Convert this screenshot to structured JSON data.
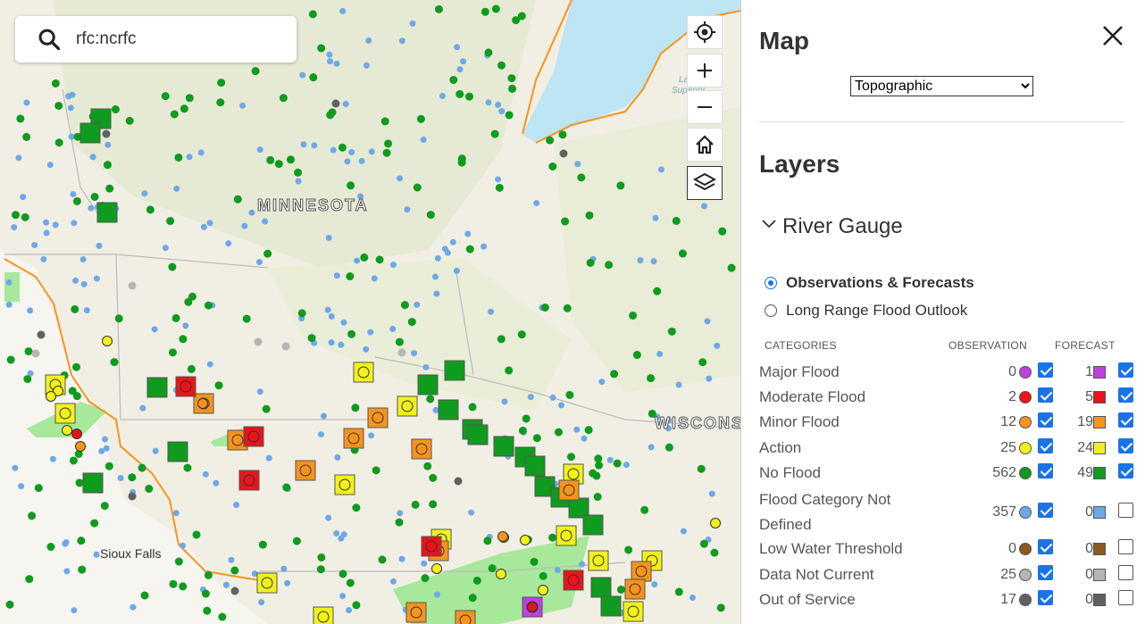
{
  "search": {
    "value": "rfc:ncrfc",
    "placeholder": ""
  },
  "map": {
    "labels": {
      "state_mn": "MINNESOTA",
      "state_wi": "WISCONSIN",
      "city_sf": "Sioux Falls",
      "lake_1": "Lake",
      "lake_2": "Superior"
    },
    "controls": [
      "locate",
      "zoom-in",
      "zoom-out",
      "home",
      "layers"
    ]
  },
  "panel": {
    "map_title": "Map",
    "basemap": {
      "selected": "Topographic",
      "options": [
        "Topographic"
      ]
    },
    "layers_title": "Layers",
    "river_gauge": {
      "label": "River Gauge",
      "expanded": true
    },
    "modes": [
      {
        "label": "Observations & Forecasts",
        "selected": true
      },
      {
        "label": "Long Range Flood Outlook",
        "selected": false
      }
    ],
    "columns": {
      "categories": "CATEGORIES",
      "observation": "OBSERVATION",
      "forecast": "FORECAST"
    },
    "categories": [
      {
        "label": "Major Flood",
        "obs": "0",
        "obs_color": "#c040e0",
        "obs_on": true,
        "fc": "1",
        "fc_color": "#c040e0",
        "fc_on": true
      },
      {
        "label": "Moderate Flood",
        "obs": "2",
        "obs_color": "#e8141b",
        "obs_on": true,
        "fc": "5",
        "fc_color": "#e8141b",
        "fc_on": true
      },
      {
        "label": "Minor Flood",
        "obs": "12",
        "obs_color": "#f7941d",
        "obs_on": true,
        "fc": "19",
        "fc_color": "#f7941d",
        "fc_on": true
      },
      {
        "label": "Action",
        "obs": "25",
        "obs_color": "#f2f21a",
        "obs_on": true,
        "fc": "24",
        "fc_color": "#f2f21a",
        "fc_on": true
      },
      {
        "label": "No Flood",
        "obs": "562",
        "obs_color": "#0f9b1e",
        "obs_on": true,
        "fc": "49",
        "fc_color": "#0f9b1e",
        "fc_on": true
      },
      {
        "label_1": "Flood Category Not",
        "label_2": "Defined",
        "obs": "357",
        "obs_color": "#6fa8e8",
        "obs_on": true,
        "fc": "0",
        "fc_color": "#6fa8e8",
        "fc_on": false
      },
      {
        "label": "Low Water Threshold",
        "obs": "0",
        "obs_color": "#8b5a1e",
        "obs_on": true,
        "fc": "0",
        "fc_color": "#8b5a1e",
        "fc_on": false
      },
      {
        "label": "Data Not Current",
        "obs": "25",
        "obs_color": "#b5b5b5",
        "obs_on": true,
        "fc": "0",
        "fc_color": "#b5b5b5",
        "fc_on": false
      },
      {
        "label": "Out of Service",
        "obs": "17",
        "obs_color": "#606060",
        "obs_on": true,
        "fc": "0",
        "fc_color": "#606060",
        "fc_on": false
      }
    ]
  }
}
